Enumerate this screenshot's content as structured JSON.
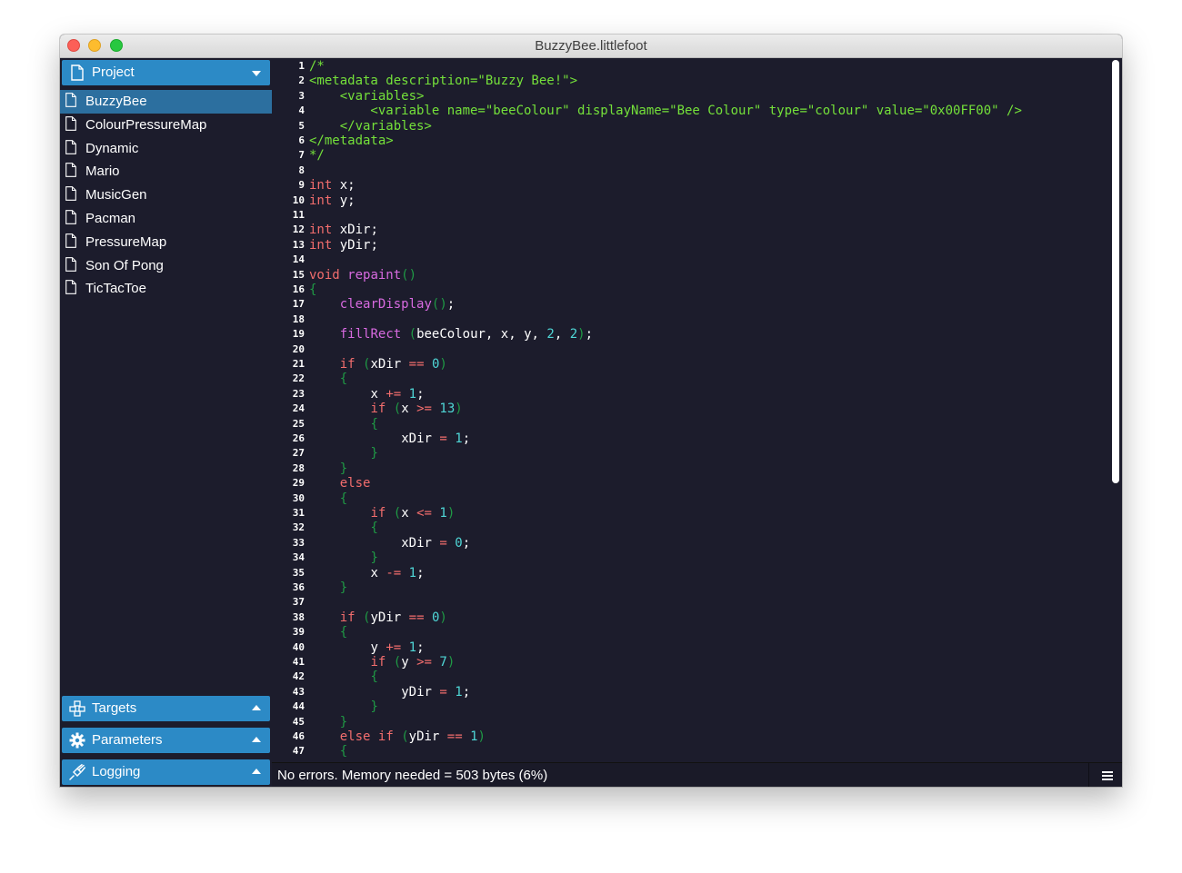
{
  "window": {
    "title": "BuzzyBee.littlefoot"
  },
  "sidebar": {
    "project_panel": {
      "label": "Project"
    },
    "files": [
      "BuzzyBee",
      "ColourPressureMap",
      "Dynamic",
      "Mario",
      "MusicGen",
      "Pacman",
      "PressureMap",
      "Son Of Pong",
      "TicTacToe"
    ],
    "selected_file": "BuzzyBee",
    "targets_panel": {
      "label": "Targets"
    },
    "parameters_panel": {
      "label": "Parameters"
    },
    "logging_panel": {
      "label": "Logging"
    }
  },
  "editor": {
    "lines": [
      "/*",
      "<metadata description=\"Buzzy Bee!\">",
      "    <variables>",
      "        <variable name=\"beeColour\" displayName=\"Bee Colour\" type=\"colour\" value=\"0x00FF00\" />",
      "    </variables>",
      "</metadata>",
      "*/",
      "",
      "int x;",
      "int y;",
      "",
      "int xDir;",
      "int yDir;",
      "",
      "void repaint()",
      "{",
      "    clearDisplay();",
      "",
      "    fillRect (beeColour, x, y, 2, 2);",
      "",
      "    if (xDir == 0)",
      "    {",
      "        x += 1;",
      "        if (x >= 13)",
      "        {",
      "            xDir = 1;",
      "        }",
      "    }",
      "    else",
      "    {",
      "        if (x <= 1)",
      "        {",
      "            xDir = 0;",
      "        }",
      "        x -= 1;",
      "    }",
      "",
      "    if (yDir == 0)",
      "    {",
      "        y += 1;",
      "        if (y >= 7)",
      "        {",
      "            yDir = 1;",
      "        }",
      "    }",
      "    else if (yDir == 1)",
      "    {"
    ]
  },
  "status": {
    "text": "No errors.  Memory needed = 503 bytes (6%)"
  },
  "colors": {
    "accent": "#2c8ac6",
    "background": "#1c1c2c",
    "comment": "#74e03a",
    "keyword": "#f26d6d",
    "function": "#d86ae0",
    "number": "#4fd6d6",
    "bracket": "#1f9a45",
    "text": "#ffffff"
  }
}
